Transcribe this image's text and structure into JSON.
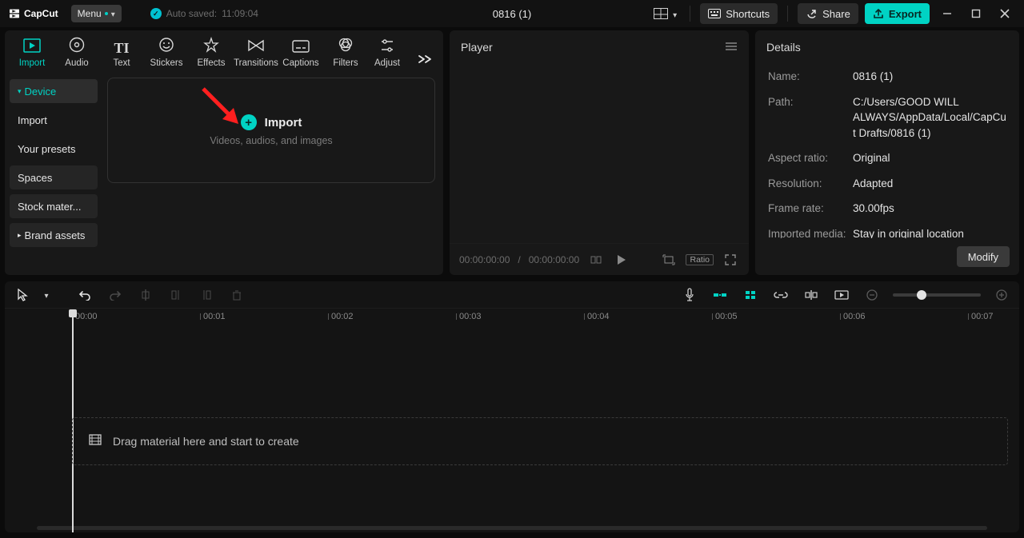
{
  "app": {
    "brand": "CapCut",
    "menu_label": "Menu",
    "autosaved_prefix": "Auto saved:",
    "autosaved_time": "11:09:04",
    "project_title": "0816 (1)"
  },
  "topbar": {
    "shortcuts": "Shortcuts",
    "share": "Share",
    "export": "Export"
  },
  "tooltabs": {
    "import": "Import",
    "audio": "Audio",
    "text": "Text",
    "stickers": "Stickers",
    "effects": "Effects",
    "transitions": "Transitions",
    "captions": "Captions",
    "filters": "Filters",
    "adjust": "Adjust"
  },
  "sidebar": {
    "device": "Device",
    "import": "Import",
    "presets": "Your presets",
    "spaces": "Spaces",
    "stock": "Stock mater...",
    "brand": "Brand assets"
  },
  "importbox": {
    "title": "Import",
    "sub": "Videos, audios, and images"
  },
  "player": {
    "title": "Player",
    "time_current": "00:00:00:00",
    "time_sep": " / ",
    "time_total": "00:00:00:00",
    "ratio_label": "Ratio"
  },
  "details": {
    "title": "Details",
    "labels": {
      "name": "Name:",
      "path": "Path:",
      "aspect": "Aspect ratio:",
      "resolution": "Resolution:",
      "framerate": "Frame rate:",
      "imported": "Imported media:"
    },
    "values": {
      "name": "0816 (1)",
      "path": "C:/Users/GOOD WILL ALWAYS/AppData/Local/CapCut Drafts/0816 (1)",
      "aspect": "Original",
      "resolution": "Adapted",
      "framerate": "30.00fps",
      "imported": "Stay in original location"
    },
    "modify": "Modify"
  },
  "timeline": {
    "ticks": [
      "00:00",
      "00:01",
      "00:02",
      "00:03",
      "00:04",
      "00:05",
      "00:06",
      "00:07"
    ],
    "drop_hint": "Drag material here and start to create"
  }
}
